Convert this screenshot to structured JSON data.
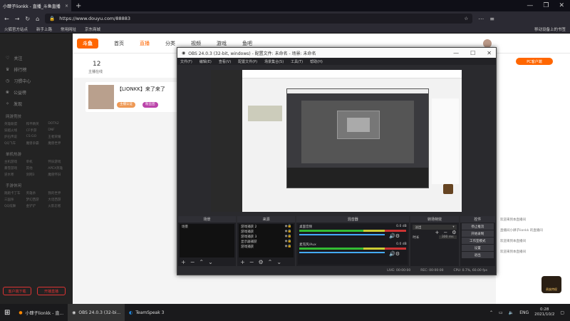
{
  "browser": {
    "tab_title": "小肆子lionkk - 直播_斗鱼直播",
    "tab_close": "×",
    "new_tab": "+",
    "window_controls": [
      "—",
      "❐",
      "✕"
    ],
    "url": "https://www.douyu.com/88883",
    "bookmarks": [
      "火狐官方站点",
      "新手上路",
      "常用网址",
      "京东商城"
    ],
    "bookmarks_right": "移动设备上的书签"
  },
  "site": {
    "logo": "斗鱼",
    "nav": [
      "首页",
      "直播",
      "分类",
      "视频",
      "游戏",
      "鱼吧"
    ],
    "active_nav": "直播",
    "left_nav": [
      "关注",
      "排行榜",
      "习惯中心",
      "公益榜",
      "发现"
    ],
    "sections": [
      "网游竞技",
      "单机热游",
      "手游休闲"
    ],
    "games": [
      [
        "英雄联盟",
        "和平精英",
        "DOTA2"
      ],
      [
        "穿越火线",
        "CF手游",
        "DNF"
      ],
      [
        "炉石传说",
        "CS:GO",
        "王者荣耀"
      ],
      [
        "QQ飞车",
        "魔兽争霸",
        "魔兽世界"
      ],
      [
        "主机游戏",
        "单机",
        "怀旧游戏"
      ],
      [
        "暴雪游戏",
        "其他",
        "APEX英雄"
      ],
      [
        "逆水寒",
        "剑网3",
        "魔兽怀旧"
      ],
      [
        "跑跑卡丁车",
        "英雄杀",
        "我的世界"
      ],
      [
        "三国杀",
        "梦幻西游",
        "大话西游"
      ],
      [
        "QQ炫舞",
        "金铲铲",
        "火影忍者"
      ]
    ],
    "left_buttons": [
      "客户端下载",
      "开播直播"
    ],
    "follow_count": "12",
    "follow_label": "主播在线",
    "room_title": "【LIONKK】来了来了",
    "room_tag": "主播认证",
    "room_tag2": "粉丝团",
    "pc_btn": "PC客户端",
    "chat": [
      "欢迎来到本直播间",
      "直播间小肆子lionkk 的直播间",
      "欢迎来到本直播间",
      "欢迎来到本直播间"
    ],
    "badge_label": "贵族特权"
  },
  "obs": {
    "title": "OBS 24.0.3 (32-bit, windows) - 配置文件: 未命名 - 场景: 未命名",
    "controls": [
      "—",
      "☐",
      "✕"
    ],
    "menu": [
      "文件(F)",
      "编辑(E)",
      "查看(V)",
      "配置文件(P)",
      "场景集合(S)",
      "工具(T)",
      "帮助(H)"
    ],
    "docks": {
      "scenes": "场景",
      "sources": "来源",
      "mixer": "混音器",
      "transitions": "转场特效",
      "controls": "控件"
    },
    "scene_list": [
      "场景"
    ],
    "source_list": [
      "游戏捕获 2",
      "游戏捕获",
      "游戏捕获 3",
      "显示器捕获",
      "游戏捕获"
    ],
    "mixer": [
      {
        "name": "桌面音频",
        "db": "0.0 dB"
      },
      {
        "name": "麦克风/Aux",
        "db": "0.0 dB"
      }
    ],
    "transition": {
      "type": "淡出",
      "duration_label": "时长",
      "duration": "300 ms"
    },
    "control_buttons": [
      "停止推流",
      "开始录制",
      "工作室模式",
      "设置",
      "退出"
    ],
    "status": [
      "LIVE: 00:00:00",
      "REC: 00:00:00",
      "CPU: 0.7%, 60.00 fps"
    ]
  },
  "taskbar": {
    "apps": [
      "小肆子lionkk - 直...",
      "OBS 24.0.3 (32-bi...",
      "TeamSpeak 3"
    ],
    "lang": "ENG",
    "time": "0:28",
    "date": "2021/10/2"
  }
}
